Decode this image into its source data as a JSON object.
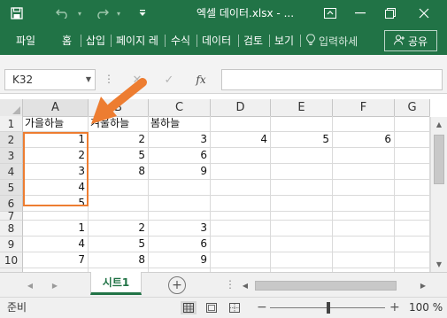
{
  "window": {
    "title": "엑셀 데이터.xlsx - ...",
    "icons": {
      "save": "save-icon",
      "undo": "undo-icon",
      "redo": "redo-icon",
      "customize": "customize-quick-access-icon",
      "ribbon_display": "ribbon-display-options-icon",
      "minimize": "minimize-icon",
      "restore": "restore-icon",
      "close": "close-icon"
    }
  },
  "ribbon": {
    "tabs": [
      "파일",
      "홈",
      "삽입",
      "페이지 레",
      "수식",
      "데이터",
      "검토",
      "보기"
    ],
    "tell_me": "입력하세",
    "share": "공유",
    "icons": {
      "tell_me": "lightbulb-icon",
      "share": "person-icon"
    }
  },
  "formula_bar": {
    "name_box": "K32",
    "formula": "",
    "fx_label": "fx",
    "icons": {
      "cancel": "cancel-x-icon",
      "enter": "checkmark-icon",
      "function": "function-fx-icon"
    }
  },
  "grid": {
    "columns": [
      "A",
      "B",
      "C",
      "D",
      "E",
      "F",
      "G"
    ],
    "row_numbers": [
      "1",
      "2",
      "3",
      "4",
      "5",
      "6",
      "7",
      "8",
      "9",
      "10",
      "11"
    ],
    "rows": [
      [
        "가을하늘",
        "겨울하늘",
        "봄하늘",
        "",
        "",
        "",
        ""
      ],
      [
        "1",
        "2",
        "3",
        "4",
        "5",
        "6",
        ""
      ],
      [
        "2",
        "5",
        "6",
        "",
        "",
        "",
        ""
      ],
      [
        "3",
        "8",
        "9",
        "",
        "",
        "",
        ""
      ],
      [
        "4",
        "",
        "",
        "",
        "",
        "",
        ""
      ],
      [
        "5",
        "",
        "",
        "",
        "",
        "",
        ""
      ],
      [
        "",
        "",
        "",
        "",
        "",
        "",
        ""
      ],
      [
        "1",
        "2",
        "3",
        "",
        "",
        "",
        ""
      ],
      [
        "4",
        "5",
        "6",
        "",
        "",
        "",
        ""
      ],
      [
        "7",
        "8",
        "9",
        "",
        "",
        "",
        ""
      ],
      [
        "",
        "",
        "",
        "",
        "",
        "",
        ""
      ]
    ],
    "highlight_range": "A2:A6",
    "highlight_color": "#ed7d31"
  },
  "sheets": {
    "tabs": [
      "시트1"
    ],
    "active": "시트1",
    "icons": {
      "add": "add-sheet-icon"
    }
  },
  "status": {
    "ready": "준비",
    "zoom": "100 %",
    "zoom_minus": "−",
    "zoom_plus": "+",
    "icons": {
      "normal": "normal-view-icon",
      "page_layout": "page-layout-view-icon",
      "page_break": "page-break-preview-icon"
    }
  },
  "colors": {
    "brand": "#217346",
    "accent": "#ed7d31"
  }
}
